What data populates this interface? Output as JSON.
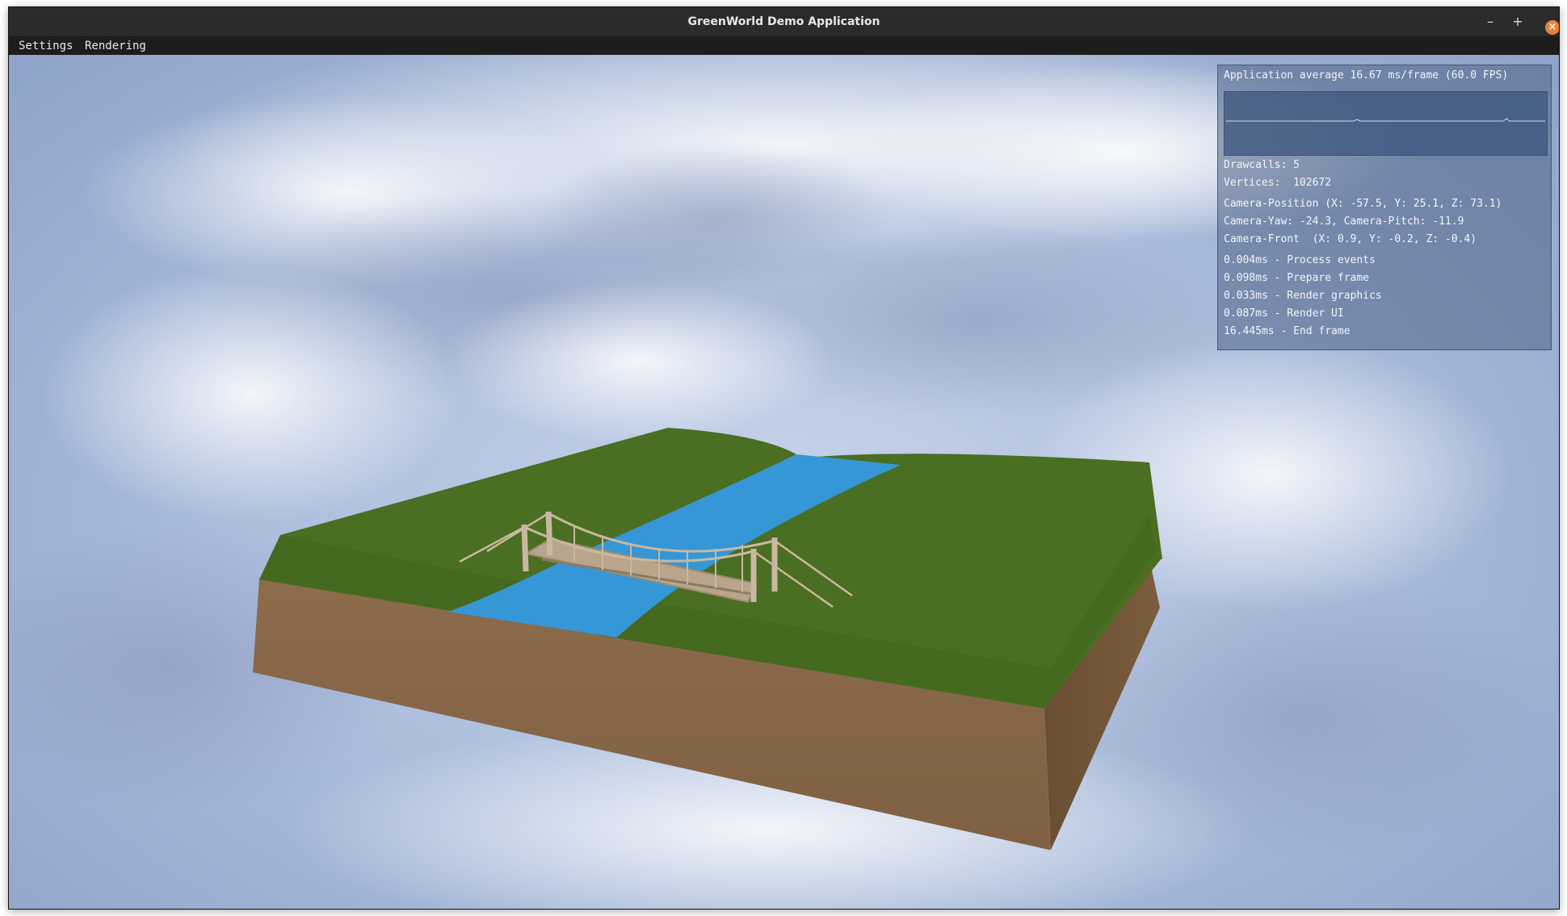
{
  "window": {
    "title": "GreenWorld Demo Application",
    "controls": {
      "minimize": "–",
      "maximize": "+",
      "close": "×"
    }
  },
  "menu": {
    "items": [
      "Settings",
      "Rendering"
    ]
  },
  "overlay": {
    "header": "Application average 16.67 ms/frame (60.0 FPS)",
    "stats": {
      "drawcalls": "Drawcalls: 5",
      "vertices": "Vertices:  102672"
    },
    "camera": {
      "position": "Camera-Position (X: -57.5, Y: 25.1, Z: 73.1)",
      "yaw_pitch": "Camera-Yaw: -24.3, Camera-Pitch: -11.9",
      "front": "Camera-Front  (X: 0.9, Y: -0.2, Z: -0.4)"
    },
    "timings": [
      "0.004ms - Process events",
      "0.098ms - Prepare frame",
      "0.033ms - Render graphics",
      "0.087ms - Render UI",
      "16.445ms - End frame"
    ]
  },
  "colors": {
    "grass": "#4a6e22",
    "grass_dark": "#3f5f1c",
    "dirt_front": "#8a6a4a",
    "dirt_side": "#735536",
    "river": "#3597d6",
    "bridge_wood": "#c9b8a0",
    "sky": "#aebfdd",
    "close_button": "#e9803a"
  }
}
